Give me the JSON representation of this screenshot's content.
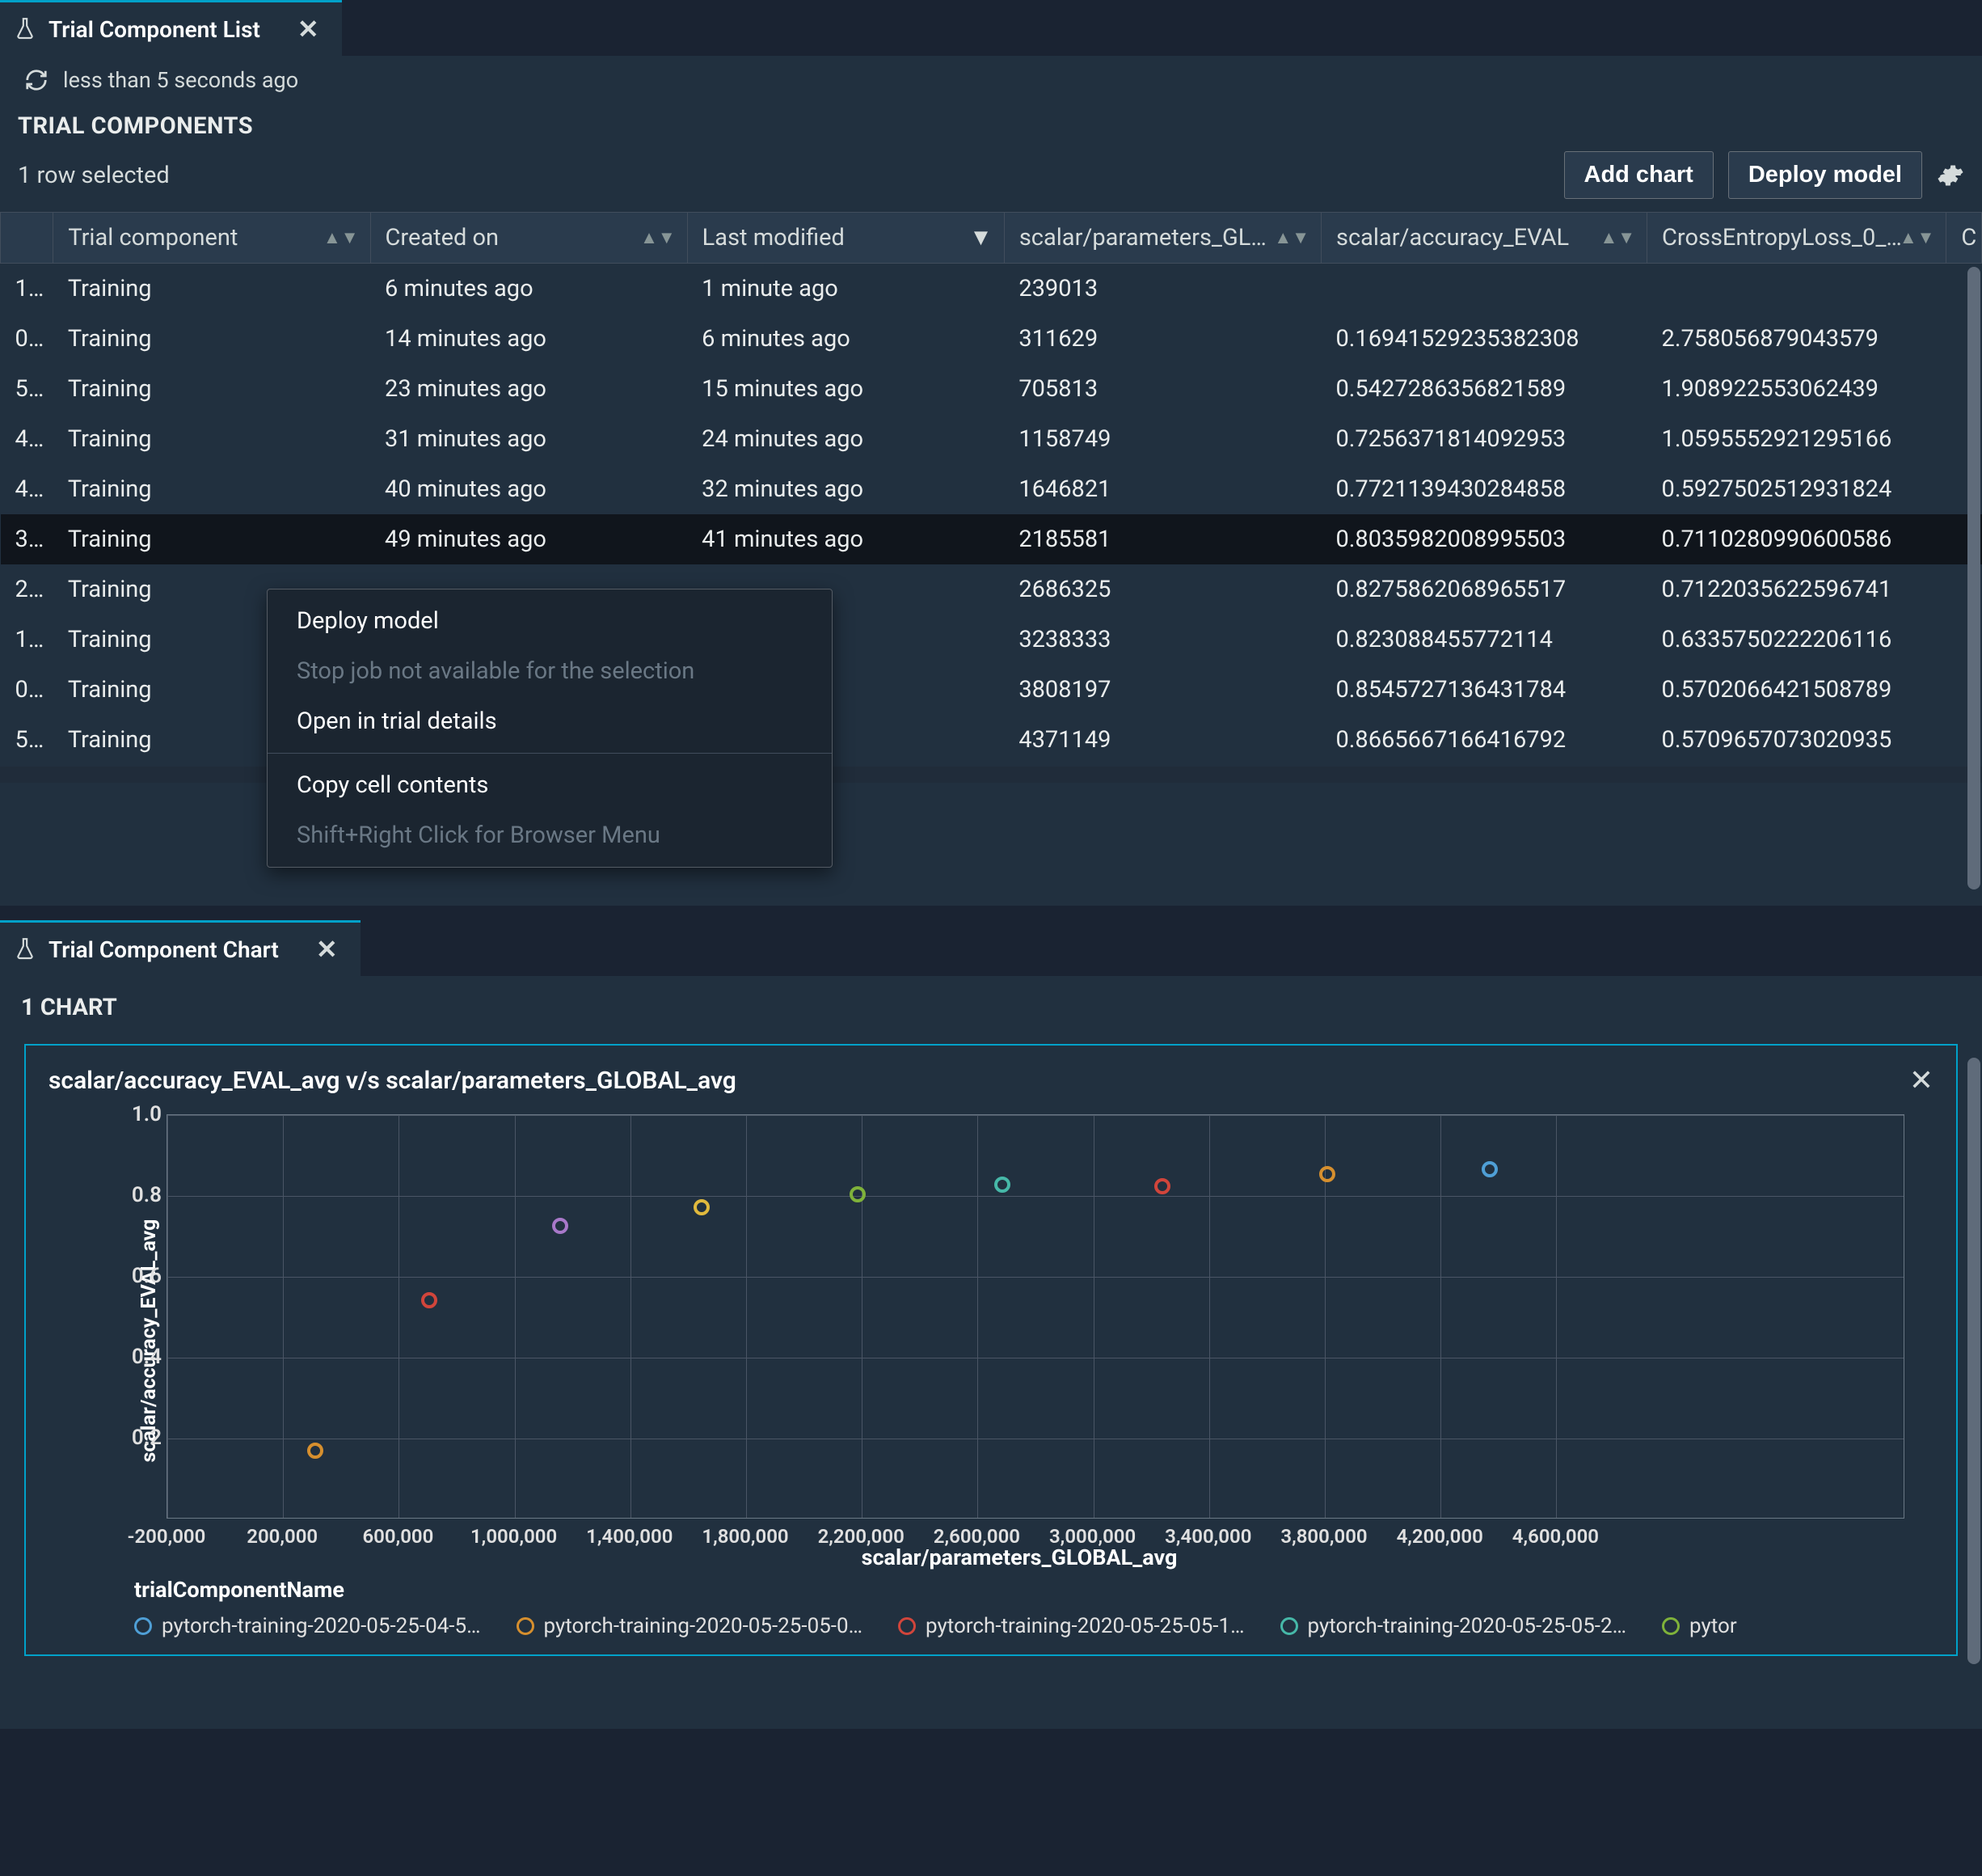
{
  "list_panel": {
    "tab_title": "Trial Component List",
    "refresh_text": "less than 5 seconds ago",
    "section_title": "TRIAL COMPONENTS",
    "selected_text": "1 row selected",
    "add_chart_btn": "Add chart",
    "deploy_btn": "Deploy model",
    "columns": {
      "trial_component": "Trial component",
      "created_on": "Created on",
      "last_modified": "Last modified",
      "params": "scalar/parameters_GL…",
      "accuracy": "scalar/accuracy_EVAL",
      "loss": "CrossEntropyLoss_0_…",
      "extra": "C"
    },
    "rows": [
      {
        "id": "1…",
        "tc": "Training",
        "created": "6 minutes ago",
        "modified": "1 minute ago",
        "params": "239013",
        "accuracy": "",
        "loss": ""
      },
      {
        "id": "0…",
        "tc": "Training",
        "created": "14 minutes ago",
        "modified": "6 minutes ago",
        "params": "311629",
        "accuracy": "0.16941529235382308",
        "loss": "2.758056879043579"
      },
      {
        "id": "5…",
        "tc": "Training",
        "created": "23 minutes ago",
        "modified": "15 minutes ago",
        "params": "705813",
        "accuracy": "0.5427286356821589",
        "loss": "1.908922553062439"
      },
      {
        "id": "4…",
        "tc": "Training",
        "created": "31 minutes ago",
        "modified": "24 minutes ago",
        "params": "1158749",
        "accuracy": "0.7256371814092953",
        "loss": "1.0595552921295166"
      },
      {
        "id": "4…",
        "tc": "Training",
        "created": "40 minutes ago",
        "modified": "32 minutes ago",
        "params": "1646821",
        "accuracy": "0.7721139430284858",
        "loss": "0.5927502512931824"
      },
      {
        "id": "3…",
        "tc": "Training",
        "created": "49 minutes ago",
        "modified": "41 minutes ago",
        "params": "2185581",
        "accuracy": "0.8035982008995503",
        "loss": "0.7110280990600586",
        "selected": true
      },
      {
        "id": "2…",
        "tc": "Training",
        "created": "",
        "modified": "",
        "params": "2686325",
        "accuracy": "0.8275862068965517",
        "loss": "0.7122035622596741"
      },
      {
        "id": "1…",
        "tc": "Training",
        "created": "",
        "modified": "",
        "params": "3238333",
        "accuracy": "0.823088455772114",
        "loss": "0.6335750222206116"
      },
      {
        "id": "0…",
        "tc": "Training",
        "created": "",
        "modified": "",
        "params": "3808197",
        "accuracy": "0.8545727136431784",
        "loss": "0.5702066421508789"
      },
      {
        "id": "5…",
        "tc": "Training",
        "created": "",
        "modified": "",
        "params": "4371149",
        "accuracy": "0.8665667166416792",
        "loss": "0.5709657073020935"
      }
    ],
    "context_menu": {
      "deploy": "Deploy model",
      "stop": "Stop job not available for the selection",
      "open": "Open in trial details",
      "copy": "Copy cell contents",
      "browser": "Shift+Right Click for Browser Menu"
    }
  },
  "chart_panel": {
    "tab_title": "Trial Component Chart",
    "section_title": "1 CHART",
    "chart_title": "scalar/accuracy_EVAL_avg v/s scalar/parameters_GLOBAL_avg",
    "ylabel": "scalar/accuracy_EVAL_avg",
    "xlabel": "scalar/parameters_GLOBAL_avg",
    "legend_title": "trialComponentName",
    "legend": [
      {
        "label": "pytorch-training-2020-05-25-04-5…",
        "color": "#4f9fd6"
      },
      {
        "label": "pytorch-training-2020-05-25-05-0…",
        "color": "#d68f2e"
      },
      {
        "label": "pytorch-training-2020-05-25-05-1…",
        "color": "#d1453b"
      },
      {
        "label": "pytorch-training-2020-05-25-05-2…",
        "color": "#46b8a8"
      },
      {
        "label": "pytor",
        "color": "#7fb23a"
      }
    ]
  },
  "chart_data": {
    "type": "scatter",
    "title": "scalar/accuracy_EVAL_avg v/s scalar/parameters_GLOBAL_avg",
    "xlabel": "scalar/parameters_GLOBAL_avg",
    "ylabel": "scalar/accuracy_EVAL_avg",
    "xlim": [
      -200000,
      4800000
    ],
    "ylim": [
      0.0,
      1.0
    ],
    "xticks": [
      -200000,
      200000,
      600000,
      1000000,
      1400000,
      1800000,
      2200000,
      2600000,
      3000000,
      3400000,
      3800000,
      4200000,
      4600000
    ],
    "yticks": [
      0.2,
      0.4,
      0.6,
      0.8,
      1.0
    ],
    "series": [
      {
        "name": "pytorch-training-2020-05-25-04-5…",
        "color": "#4f9fd6",
        "points": [
          [
            4371149,
            0.8666
          ]
        ]
      },
      {
        "name": "pytorch-training-2020-05-25-05-0…",
        "color": "#d68f2e",
        "points": [
          [
            3808197,
            0.8546
          ],
          [
            311629,
            0.1694
          ]
        ]
      },
      {
        "name": "pytorch-training-2020-05-25-05-1…",
        "color": "#d1453b",
        "points": [
          [
            3238333,
            0.8231
          ],
          [
            705813,
            0.5427
          ]
        ]
      },
      {
        "name": "pytorch-training-2020-05-25-05-2…",
        "color": "#46b8a8",
        "points": [
          [
            2686325,
            0.8276
          ]
        ]
      },
      {
        "name": "pytorch-training-…",
        "color": "#7fb23a",
        "points": [
          [
            2185581,
            0.8036
          ]
        ]
      },
      {
        "name": "pytorch-training-…",
        "color": "#e0b93d",
        "points": [
          [
            1646821,
            0.7721
          ]
        ]
      },
      {
        "name": "pytorch-training-…",
        "color": "#a878c9",
        "points": [
          [
            1158749,
            0.7256
          ]
        ]
      }
    ]
  }
}
